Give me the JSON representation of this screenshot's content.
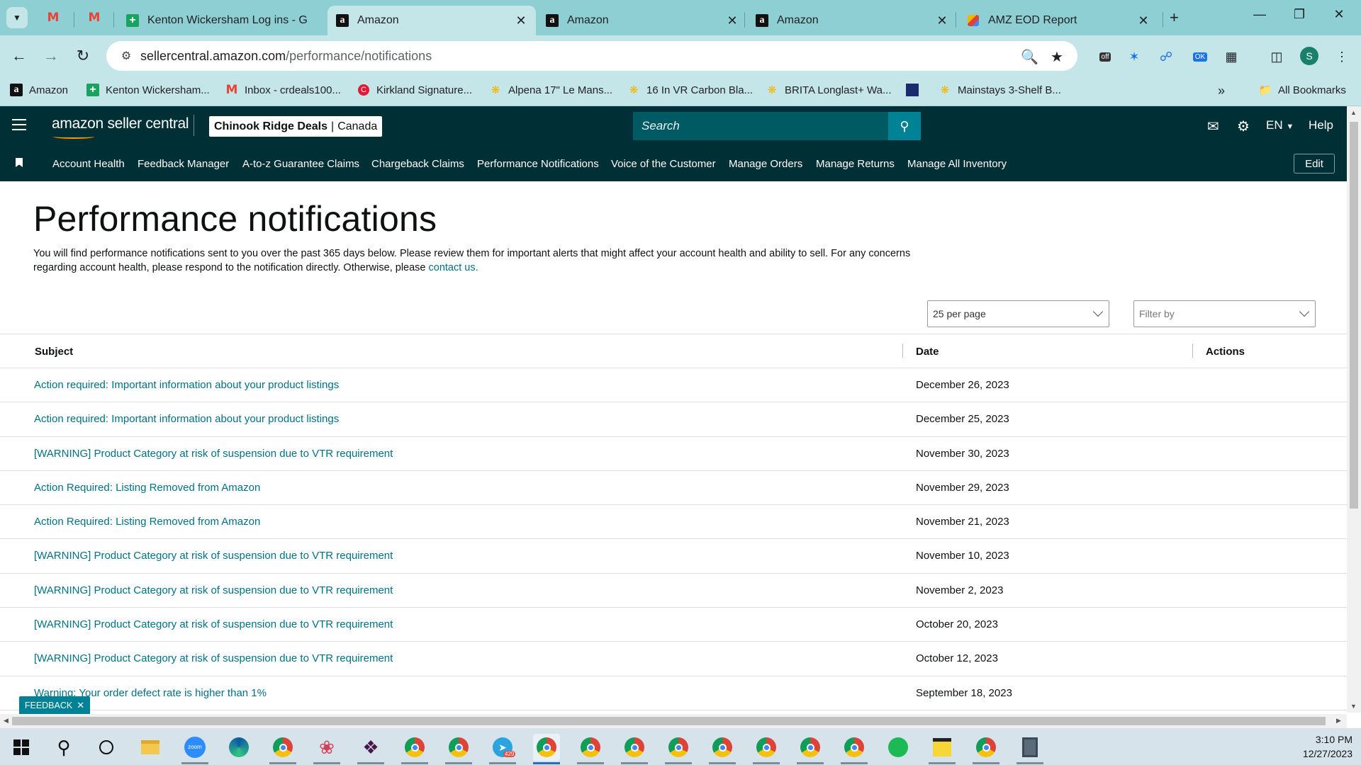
{
  "browser": {
    "tabs": [
      {
        "title": "",
        "favicon": "gmail-icon"
      },
      {
        "title": "",
        "favicon": "gmail-icon"
      },
      {
        "title": "Kenton Wickersham Log ins - G",
        "favicon": "green-plus-icon"
      },
      {
        "title": "Amazon",
        "favicon": "amazon-icon",
        "active": true
      },
      {
        "title": "Amazon",
        "favicon": "amazon-icon"
      },
      {
        "title": "Amazon",
        "favicon": "amazon-icon"
      },
      {
        "title": "AMZ EOD Report",
        "favicon": "report-icon"
      }
    ],
    "url_domain": "sellercentral.amazon.com",
    "url_path": "/performance/notifications",
    "profile_initial": "S",
    "bookmarks": [
      {
        "label": "Amazon",
        "icon": "amazon-icon"
      },
      {
        "label": "Kenton Wickersham...",
        "icon": "green-plus-icon"
      },
      {
        "label": "Inbox - crdeals100...",
        "icon": "gmail-icon"
      },
      {
        "label": "Kirkland Signature...",
        "icon": "costco-icon"
      },
      {
        "label": "Alpena 17\" Le Mans...",
        "icon": "walmart-spark-icon"
      },
      {
        "label": "16 In VR Carbon Bla...",
        "icon": "walmart-spark-icon"
      },
      {
        "label": "BRITA Longlast+ Wa...",
        "icon": "walmart-spark-icon"
      },
      {
        "label": "",
        "icon": "app-icon"
      },
      {
        "label": "Mainstays 3-Shelf B...",
        "icon": "walmart-spark-icon"
      }
    ],
    "all_bookmarks_label": "All Bookmarks"
  },
  "seller_central": {
    "brand": "amazon seller central",
    "store_name": "Chinook Ridge Deals",
    "marketplace": "Canada",
    "search_placeholder": "Search",
    "language": "EN",
    "help_label": "Help",
    "nav_links": [
      "Account Health",
      "Feedback Manager",
      "A-to-z Guarantee Claims",
      "Chargeback Claims",
      "Performance Notifications",
      "Voice of the Customer",
      "Manage Orders",
      "Manage Returns",
      "Manage All Inventory"
    ],
    "edit_label": "Edit"
  },
  "page": {
    "title": "Performance notifications",
    "intro_text": "You will find performance notifications sent to you over the past 365 days below. Please review them for important alerts that might affect your account health and ability to sell. For any concerns regarding account health, please respond to the notification directly. Otherwise, please",
    "contact_link": "contact us.",
    "per_page_value": "25 per page",
    "filter_placeholder": "Filter by",
    "columns": {
      "subject": "Subject",
      "date": "Date",
      "actions": "Actions"
    },
    "rows": [
      {
        "subject": "Action required: Important information about your product listings",
        "date": "December 26, 2023"
      },
      {
        "subject": "Action required: Important information about your product listings",
        "date": "December 25, 2023"
      },
      {
        "subject": "[WARNING] Product Category at risk of suspension due to VTR requirement",
        "date": "November 30, 2023"
      },
      {
        "subject": "Action Required: Listing Removed from Amazon",
        "date": "November 29, 2023"
      },
      {
        "subject": "Action Required: Listing Removed from Amazon",
        "date": "November 21, 2023"
      },
      {
        "subject": "[WARNING] Product Category at risk of suspension due to VTR requirement",
        "date": "November 10, 2023"
      },
      {
        "subject": "[WARNING] Product Category at risk of suspension due to VTR requirement",
        "date": "November 2, 2023"
      },
      {
        "subject": "[WARNING] Product Category at risk of suspension due to VTR requirement",
        "date": "October 20, 2023"
      },
      {
        "subject": "[WARNING] Product Category at risk of suspension due to VTR requirement",
        "date": "October 12, 2023"
      },
      {
        "subject": "Warning: Your order defect rate is higher than 1%",
        "date": "September 18, 2023"
      }
    ],
    "feedback_label": "FEEDBACK"
  },
  "taskbar": {
    "time": "3:10 PM",
    "date": "12/27/2023",
    "telegram_badge": "429"
  },
  "colors": {
    "header_bg": "#002f36",
    "link": "#007185",
    "search_button": "#008296",
    "chrome_frame": "#8ecfd4"
  }
}
